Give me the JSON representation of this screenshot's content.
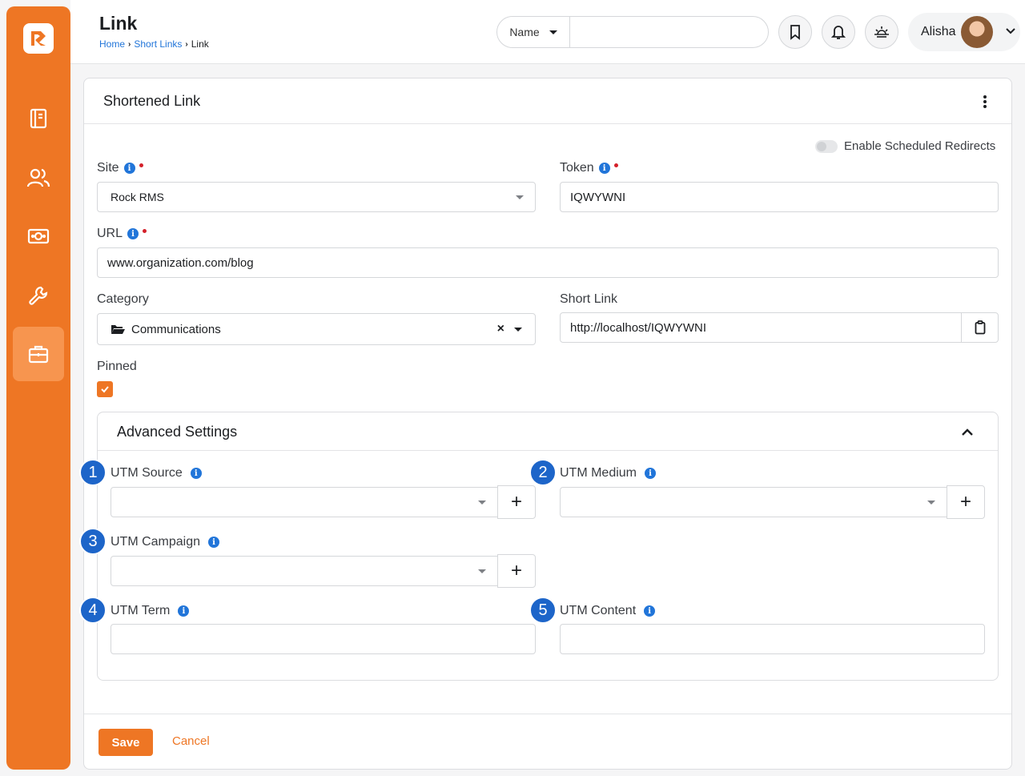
{
  "header": {
    "title": "Link",
    "breadcrumb": [
      "Home",
      "Short Links",
      "Link"
    ],
    "search_type": "Name",
    "search_placeholder": "",
    "user_name": "Alisha"
  },
  "sidebar": {
    "items": [
      {
        "icon": "book-icon"
      },
      {
        "icon": "people-icon"
      },
      {
        "icon": "money-icon"
      },
      {
        "icon": "wrench-icon"
      },
      {
        "icon": "briefcase-icon",
        "active": true
      }
    ]
  },
  "card": {
    "title": "Shortened Link",
    "scheduled_toggle_label": "Enable Scheduled Redirects",
    "site_label": "Site",
    "site_value": "Rock RMS",
    "token_label": "Token",
    "token_value": "IQWYWNI",
    "url_label": "URL",
    "url_value": "www.organization.com/blog",
    "category_label": "Category",
    "category_value": "Communications",
    "short_link_label": "Short Link",
    "short_link_value": "http://localhost/IQWYWNI",
    "pinned_label": "Pinned",
    "pinned": true
  },
  "advanced": {
    "title": "Advanced Settings",
    "utm_source_label": "UTM Source",
    "utm_medium_label": "UTM Medium",
    "utm_campaign_label": "UTM Campaign",
    "utm_term_label": "UTM Term",
    "utm_content_label": "UTM Content",
    "badges": [
      "1",
      "2",
      "3",
      "4",
      "5"
    ]
  },
  "footer": {
    "save_label": "Save",
    "cancel_label": "Cancel"
  },
  "colors": {
    "accent": "#ee7624",
    "info": "#2175d9",
    "required": "#d4202a",
    "badge": "#1d65c9"
  }
}
